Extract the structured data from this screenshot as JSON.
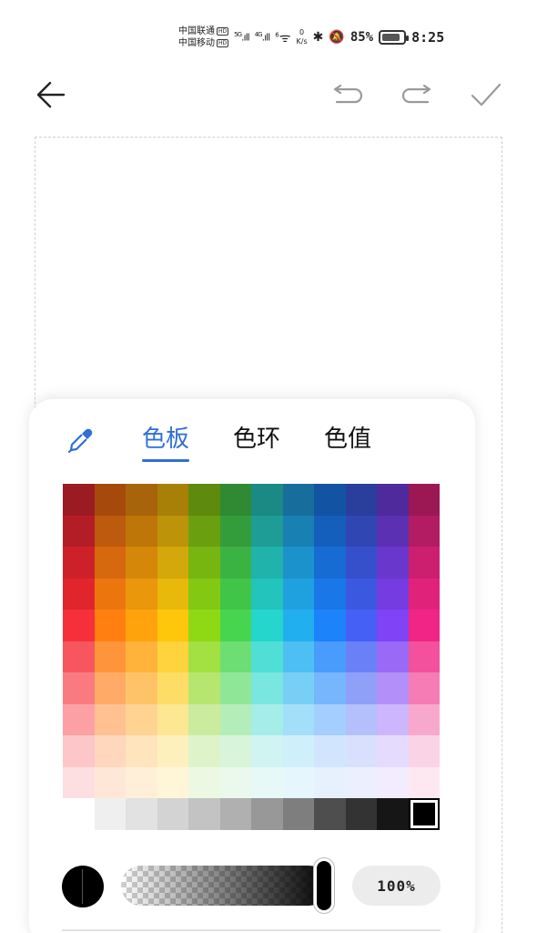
{
  "status_bar": {
    "carrier_1": "中国联通",
    "carrier_2": "中国移动",
    "hd_badge": "HD",
    "signal_1": "5G",
    "signal_2": "4G",
    "wifi_label": "6",
    "speed_value": "0",
    "speed_unit": "K/s",
    "battery_percent": "85%",
    "battery_level": 0.85,
    "time": "8:25"
  },
  "toolbar": {
    "back_icon": "back-arrow-icon",
    "undo_icon": "undo-icon",
    "redo_icon": "redo-icon",
    "confirm_icon": "check-icon"
  },
  "panel": {
    "eyedropper_icon": "eyedropper-icon",
    "tabs": [
      {
        "label": "色板",
        "active": true
      },
      {
        "label": "色环",
        "active": false
      },
      {
        "label": "色值",
        "active": false
      }
    ],
    "palette_rows": [
      [
        "#9b1b22",
        "#a64a0c",
        "#a8640a",
        "#a88008",
        "#5e8a0d",
        "#2f8a33",
        "#1b8a84",
        "#176e9c",
        "#1253a3",
        "#2a3e9c",
        "#4f2a9c",
        "#9c1855"
      ],
      [
        "#b31e26",
        "#bc5a0d",
        "#be7609",
        "#bd9309",
        "#6aa00f",
        "#349d3b",
        "#1d9d96",
        "#1980b4",
        "#145fbb",
        "#3046b3",
        "#5c30b3",
        "#b31b62"
      ],
      [
        "#cc2128",
        "#d6680d",
        "#d5870a",
        "#d4a70a",
        "#77b611",
        "#3bb343",
        "#20b3ab",
        "#1c92cc",
        "#176cd4",
        "#3650cc",
        "#6937cc",
        "#cc1f6f"
      ],
      [
        "#e1252d",
        "#ec760e",
        "#ea970b",
        "#e8b80b",
        "#83c813",
        "#41c549",
        "#22c4bb",
        "#1fa1e0",
        "#1a77e8",
        "#3b58e1",
        "#743ce1",
        "#e1227b"
      ],
      [
        "#f5303a",
        "#ff7f0f",
        "#ffa30c",
        "#fec70c",
        "#8fd914",
        "#47d550",
        "#25d6cc",
        "#22afef",
        "#1c83fb",
        "#4460f5",
        "#8043f5",
        "#f02586"
      ],
      [
        "#f7565e",
        "#ff953b",
        "#ffb33b",
        "#fed33b",
        "#a3e042",
        "#6cde74",
        "#4fdfd6",
        "#4dbff2",
        "#4a9cfc",
        "#6a80f7",
        "#9a6af7",
        "#f3509d"
      ],
      [
        "#f97b81",
        "#ffab67",
        "#ffc367",
        "#fedd67",
        "#b7e670",
        "#90e697",
        "#79e6df",
        "#78cff5",
        "#77b5fd",
        "#8fa0f9",
        "#b390f9",
        "#f67cb5"
      ],
      [
        "#fba1a5",
        "#ffc192",
        "#ffd492",
        "#fee792",
        "#cbec9e",
        "#b4edb9",
        "#a4ede8",
        "#a3dff8",
        "#a4cefd",
        "#b4c0fb",
        "#cdb6fb",
        "#f9a8cd"
      ],
      [
        "#fdc6c9",
        "#ffd7bd",
        "#ffe4bd",
        "#fef0bd",
        "#dff3cb",
        "#d8f4db",
        "#cff4f1",
        "#cfeffb",
        "#d1e6fe",
        "#d9e0fd",
        "#e5dbfd",
        "#fbd3e6"
      ],
      [
        "#fedfe1",
        "#ffe7d8",
        "#ffefd8",
        "#fff6d8",
        "#edf8e2",
        "#ebf9ed",
        "#e6f9f7",
        "#e6f6fd",
        "#e7f1fe",
        "#eceffe",
        "#f2ecfe",
        "#fde8f2"
      ],
      [
        "#ffffff",
        "#efefef",
        "#e2e2e2",
        "#d3d3d3",
        "#c3c3c3",
        "#b0b0b0",
        "#989898",
        "#7e7e7e",
        "#4e4e4e",
        "#333333",
        "#161616",
        "#000000"
      ]
    ],
    "selected_swatch": "#000000",
    "current_color": "#000000",
    "opacity_level": 1.0,
    "opacity_text": "100%",
    "accent_color": "#2f6fd6"
  }
}
